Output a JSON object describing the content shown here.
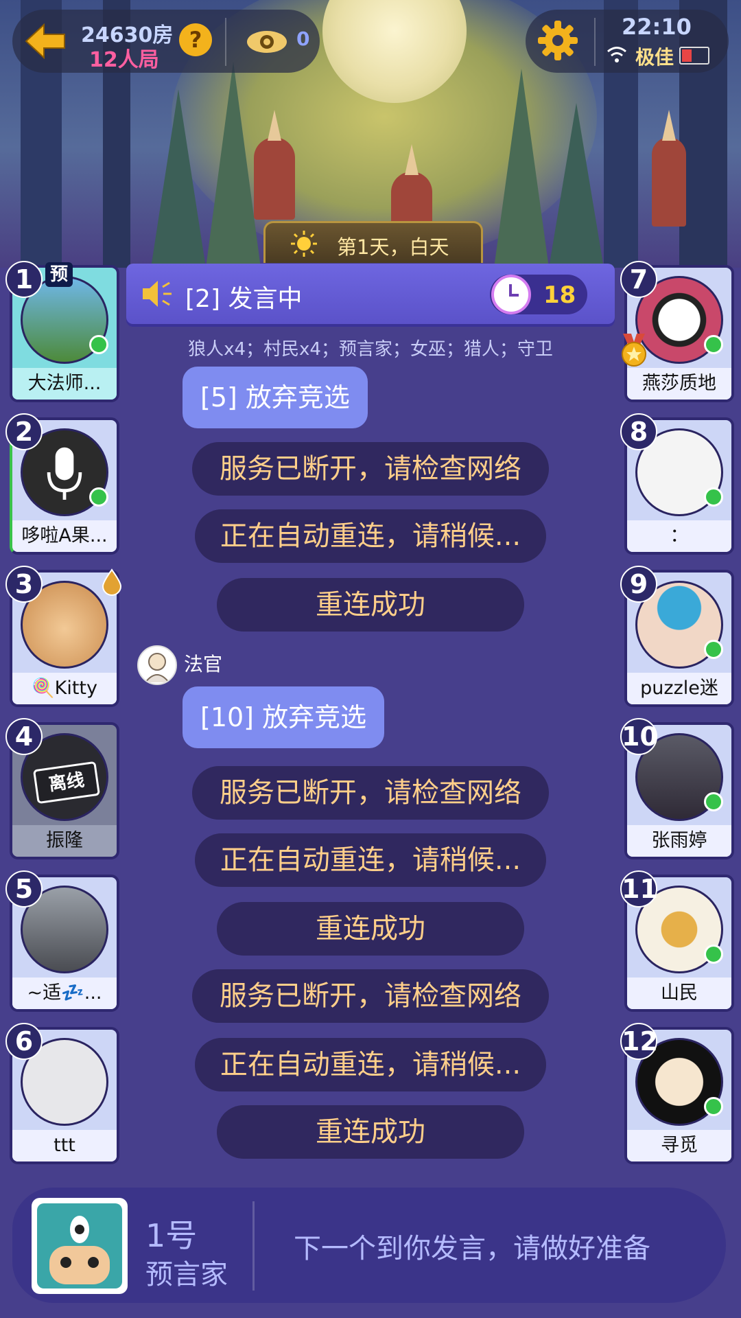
{
  "header": {
    "room_number": "24630房",
    "room_type": "12人局",
    "help_label": "?",
    "viewer_count": "0",
    "time": "22:10",
    "network_label": "极佳"
  },
  "phase": {
    "label": "第1天，白天"
  },
  "speaking": {
    "label": "[2] 发言中",
    "countdown": "18"
  },
  "roles_summary": "狼人x4；村民x4；预言家；女巫；猎人；守卫",
  "chat": {
    "judge_name": "法官",
    "messages": [
      "[5] 放弃竞选",
      "服务已断开，请检查网络",
      "正在自动重连，请稍候...",
      "重连成功",
      "[10] 放弃竞选",
      "服务已断开，请检查网络",
      "正在自动重连，请稍候...",
      "重连成功",
      "服务已断开，请检查网络",
      "正在自动重连，请稍候...",
      "重连成功"
    ]
  },
  "players": [
    {
      "number": "1",
      "name": "大法师...",
      "tag": "预"
    },
    {
      "number": "2",
      "name": "哆啦A果..."
    },
    {
      "number": "3",
      "name": "🍭Kitty"
    },
    {
      "number": "4",
      "name": "振隆",
      "stamp": "离线"
    },
    {
      "number": "5",
      "name": "~适💤..."
    },
    {
      "number": "6",
      "name": "ttt"
    },
    {
      "number": "7",
      "name": "燕莎质地"
    },
    {
      "number": "8",
      "name": "："
    },
    {
      "number": "9",
      "name": "puzzle迷"
    },
    {
      "number": "10",
      "name": "张雨婷"
    },
    {
      "number": "11",
      "name": "山民"
    },
    {
      "number": "12",
      "name": "寻觅"
    }
  ],
  "me": {
    "seat": "1号",
    "role": "预言家",
    "prompt": "下一个到你发言，请做好准备"
  }
}
